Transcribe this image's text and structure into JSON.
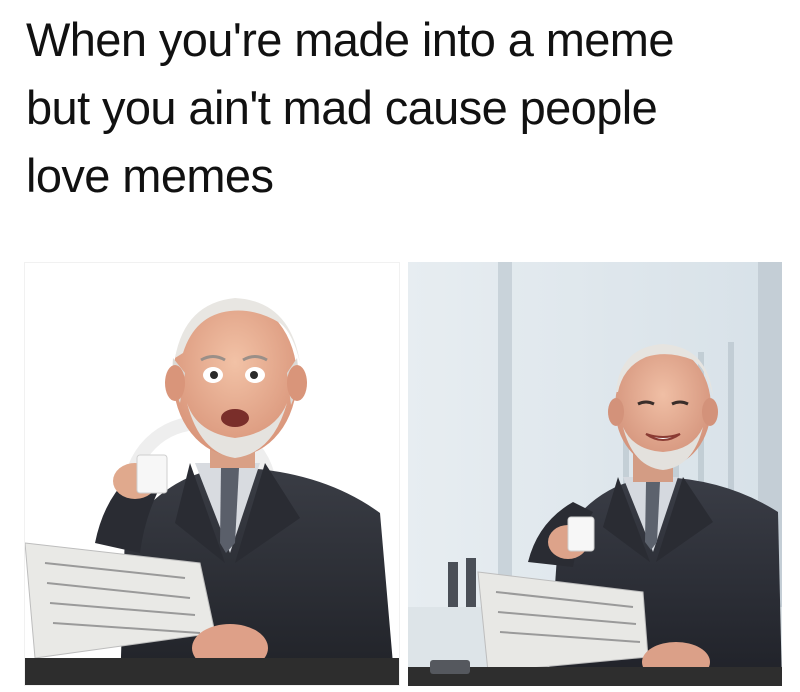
{
  "caption": {
    "text": "When you're made into a meme\nbut you ain't mad cause people\nlove memes"
  },
  "panels": [
    {
      "subject": "man-surprised-with-coffee-and-newspaper",
      "background": "white-studio"
    },
    {
      "subject": "man-smiling-with-coffee-and-newspaper",
      "background": "bright-office"
    }
  ]
}
